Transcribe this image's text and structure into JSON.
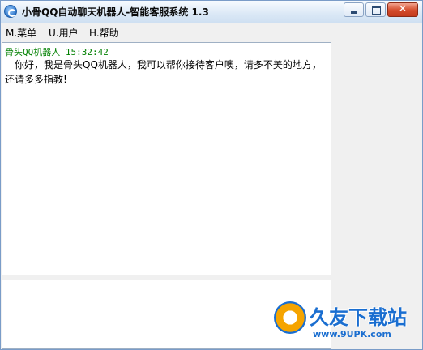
{
  "window": {
    "title": "小骨QQ自动聊天机器人-智能客服系统 1.3",
    "close_glyph": "✕"
  },
  "menu": [
    {
      "label": "M.菜单"
    },
    {
      "label": "U.用户"
    },
    {
      "label": "H.帮助"
    }
  ],
  "chat": {
    "sender_time": "骨头QQ机器人 15:32:42",
    "message": "你好，我是骨头QQ机器人，我可以帮你接待客户噢，请多不美的地方，还请多多指教!"
  },
  "input": {
    "value": ""
  },
  "watermark": {
    "title": "久友下载站",
    "url": "www.9UPK.com"
  },
  "colors": {
    "sender": "#008000",
    "brand": "#1a6ed0"
  }
}
